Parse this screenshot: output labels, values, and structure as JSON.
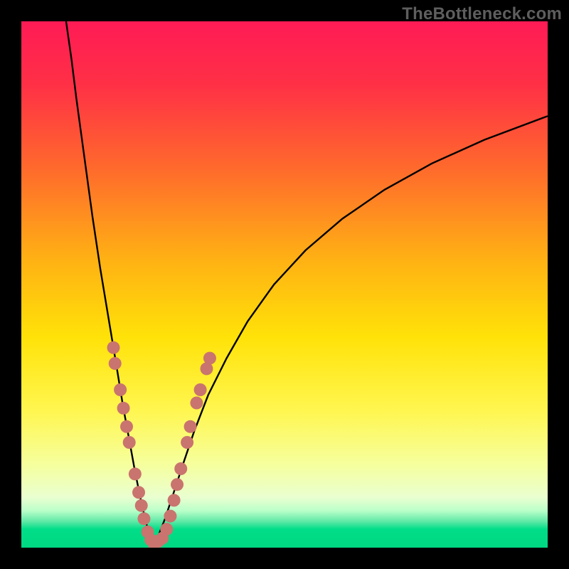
{
  "watermark": "TheBottleneck.com",
  "colors": {
    "background": "#000000",
    "curve_stroke": "#000000",
    "dot_fill": "#c9746e",
    "gradient_stops": [
      {
        "offset": 0.0,
        "color": "#ff1b55"
      },
      {
        "offset": 0.12,
        "color": "#ff3046"
      },
      {
        "offset": 0.28,
        "color": "#ff6a2c"
      },
      {
        "offset": 0.45,
        "color": "#ffb014"
      },
      {
        "offset": 0.6,
        "color": "#ffe208"
      },
      {
        "offset": 0.74,
        "color": "#fff650"
      },
      {
        "offset": 0.84,
        "color": "#f6ff9c"
      },
      {
        "offset": 0.905,
        "color": "#e9ffd0"
      },
      {
        "offset": 0.93,
        "color": "#b9ffc9"
      },
      {
        "offset": 0.95,
        "color": "#60e9a6"
      },
      {
        "offset": 0.965,
        "color": "#00dd88"
      },
      {
        "offset": 1.0,
        "color": "#00d882"
      }
    ]
  },
  "chart_data": {
    "type": "line",
    "title": "",
    "xlabel": "",
    "ylabel": "",
    "xlim": [
      0,
      100
    ],
    "ylim": [
      0,
      100
    ],
    "grid": false,
    "legend": false,
    "vertex_x": 25,
    "series": [
      {
        "name": "left-branch",
        "x": [
          8.5,
          9.5,
          10.5,
          12,
          13.5,
          15,
          16.5,
          18,
          19.3,
          20.5,
          21.5,
          22.5,
          23.4,
          24.2,
          25
        ],
        "y": [
          100,
          93,
          85,
          74,
          63,
          53,
          44,
          35,
          27,
          20.5,
          15,
          10,
          6,
          2.8,
          0.3
        ]
      },
      {
        "name": "right-branch",
        "x": [
          25,
          26,
          27.3,
          28.8,
          30.6,
          32.8,
          35.5,
          39,
          43,
          48,
          54,
          61,
          69,
          78,
          88,
          100
        ],
        "y": [
          0.3,
          2.2,
          5.5,
          10,
          15.5,
          22,
          29,
          36,
          43,
          50,
          56.5,
          62.5,
          68,
          73,
          77.5,
          82
        ]
      }
    ],
    "scatter_points": {
      "name": "highlighted-points",
      "points": [
        {
          "x": 17.5,
          "y": 38
        },
        {
          "x": 17.8,
          "y": 35
        },
        {
          "x": 18.8,
          "y": 30
        },
        {
          "x": 19.4,
          "y": 26.5
        },
        {
          "x": 20.0,
          "y": 23
        },
        {
          "x": 20.5,
          "y": 20
        },
        {
          "x": 21.6,
          "y": 14
        },
        {
          "x": 22.3,
          "y": 10.5
        },
        {
          "x": 22.8,
          "y": 8
        },
        {
          "x": 23.3,
          "y": 5.5
        },
        {
          "x": 24.0,
          "y": 3
        },
        {
          "x": 24.6,
          "y": 1.5
        },
        {
          "x": 25.2,
          "y": 0.8
        },
        {
          "x": 26.0,
          "y": 1.2
        },
        {
          "x": 26.8,
          "y": 1.8
        },
        {
          "x": 27.6,
          "y": 3.5
        },
        {
          "x": 28.3,
          "y": 6
        },
        {
          "x": 29.0,
          "y": 9
        },
        {
          "x": 29.6,
          "y": 12
        },
        {
          "x": 30.3,
          "y": 15
        },
        {
          "x": 31.5,
          "y": 20
        },
        {
          "x": 32.1,
          "y": 23
        },
        {
          "x": 33.3,
          "y": 27.5
        },
        {
          "x": 34.0,
          "y": 30
        },
        {
          "x": 35.2,
          "y": 34
        },
        {
          "x": 35.8,
          "y": 36
        }
      ],
      "radius": 9
    }
  }
}
